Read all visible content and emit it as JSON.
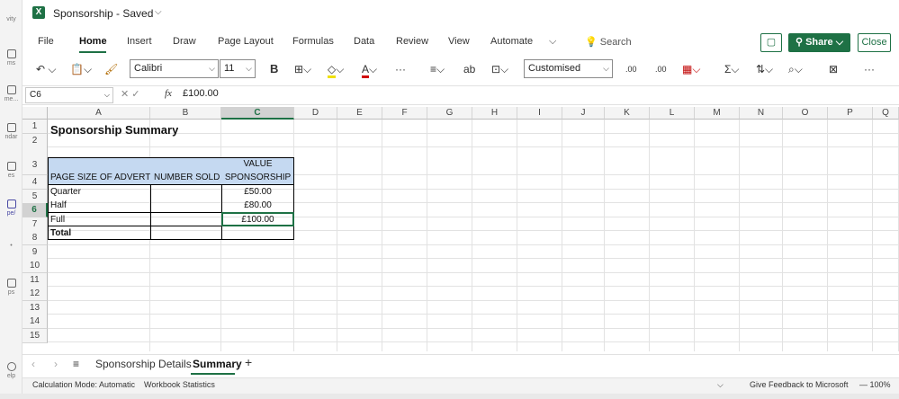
{
  "left_rail": [
    "vity",
    "ms",
    "me...",
    "ndar",
    "es",
    "pe/",
    "ps",
    "elp"
  ],
  "app": {
    "logo": "X",
    "title": "Sponsorship - Saved"
  },
  "menu": [
    "File",
    "Home",
    "Insert",
    "Draw",
    "Page Layout",
    "Formulas",
    "Data",
    "Review",
    "View",
    "Automate"
  ],
  "search_placeholder": "Search",
  "share_label": "Share",
  "close_label": "Close",
  "ribbon": {
    "font_name": "Calibri",
    "font_size": "11",
    "bold": "B",
    "number_format": "Customised",
    "inc_decimal": ".00",
    "dec_decimal": ".00"
  },
  "formula_bar": {
    "name_box": "C6",
    "fx": "fx",
    "value": "£100.00"
  },
  "columns": [
    "A",
    "B",
    "C",
    "D",
    "E",
    "F",
    "G",
    "H",
    "I",
    "J",
    "K",
    "L",
    "M",
    "N",
    "O",
    "P",
    "Q"
  ],
  "rows": [
    "1",
    "2",
    "3",
    "4",
    "5",
    "6",
    "7",
    "8",
    "9",
    "10",
    "11",
    "12",
    "13",
    "14",
    "15"
  ],
  "sheet": {
    "title": "Sponsorship Summary",
    "header_a": "PAGE SIZE OF ADVERT",
    "header_b": "NUMBER SOLD",
    "header_c_line1": "VALUE",
    "header_c_line2": "SPONSORSHIP",
    "rows": [
      {
        "size": "Quarter",
        "value": "£50.00"
      },
      {
        "size": "Half",
        "value": "£80.00"
      },
      {
        "size": "Full",
        "value": "£100.00"
      }
    ],
    "total_label": "Total"
  },
  "sheet_tabs": [
    "Sponsorship Details",
    "Summary"
  ],
  "status": {
    "calc_mode": "Calculation Mode: Automatic",
    "workbook_stats": "Workbook Statistics",
    "feedback": "Give Feedback to Microsoft",
    "zoom": "100%"
  },
  "colors": {
    "excel_green": "#1e7145",
    "header_fill": "#c5d9f1"
  }
}
